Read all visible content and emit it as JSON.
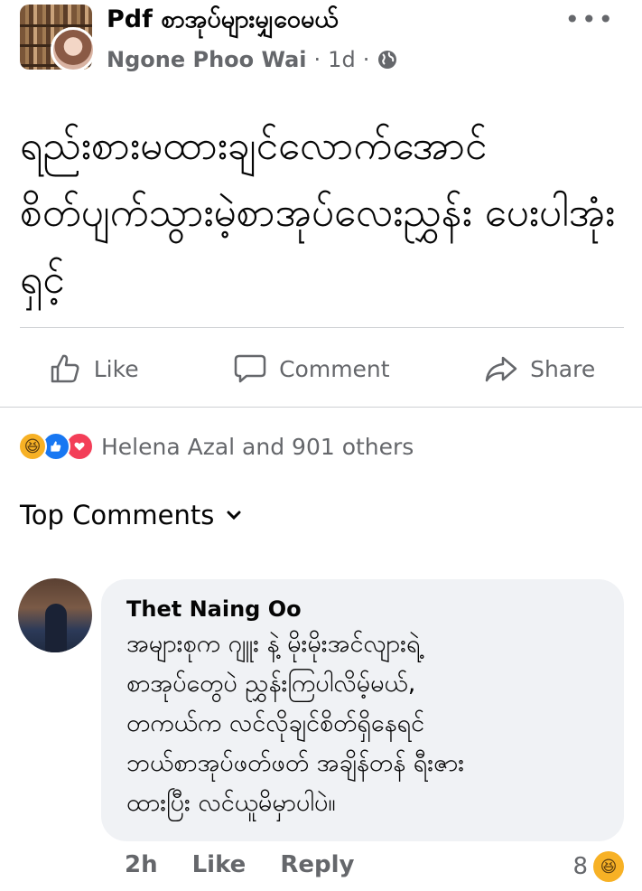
{
  "post": {
    "group_name": "Pdf စာအုပ်များမျှဝေမယ်",
    "author": "Ngone Phoo Wai",
    "separator": "·",
    "time": "1d",
    "privacy_icon": "globe-icon",
    "more_icon": "more-dots-icon",
    "text": "ရည်းစားမထားချင်လောက်အောင် စိတ်ပျက်သွားမဲ့စာအုပ်လေးညွှန်း ပေးပါအုံးရှင့်"
  },
  "actions": {
    "like_label": "Like",
    "comment_label": "Comment",
    "share_label": "Share"
  },
  "reactions": {
    "summary": "Helena Azal and 901 others",
    "icons": [
      "haha-icon",
      "like-icon",
      "love-icon"
    ]
  },
  "comments_header": {
    "label": "Top Comments",
    "chevron_icon": "chevron-down-icon"
  },
  "comment": {
    "name": "Thet Naing Oo",
    "lines": [
      "အများစုက ဂျူး နဲ့ မိုးမိုးအင်လျားရဲ့",
      "စာအုပ်တွေပဲ ညွှန်းကြပါလိမ့်မယ်,",
      "တကယ်က လင်လိုချင်စိတ်ရှိနေရင်",
      "ဘယ်စာအုပ်ဖတ်ဖတ် အချိန်တန် ရီးဇား",
      "ထားပြီး လင်ယူမိမှာပါပဲ။"
    ],
    "time": "2h",
    "like_label": "Like",
    "reply_label": "Reply",
    "reaction_count": "8",
    "reaction_icon": "haha-icon"
  },
  "colors": {
    "secondary_text": "#65676b",
    "bubble_bg": "#f0f2f5",
    "like_blue": "#1877f2",
    "love_red": "#f33e58",
    "haha_yellow": "#f7b125"
  }
}
